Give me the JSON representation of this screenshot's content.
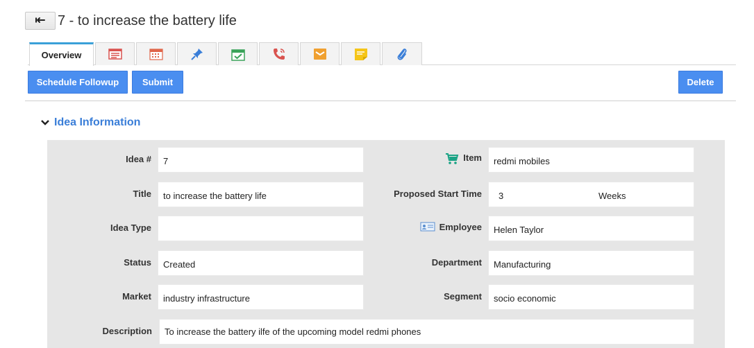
{
  "header": {
    "back_icon": "back-arrow-icon",
    "title": "7 - to increase the battery life"
  },
  "tabs": [
    {
      "label": "Overview",
      "icon": null
    },
    {
      "label": "",
      "icon": "notes-list-icon"
    },
    {
      "label": "",
      "icon": "calendar-icon"
    },
    {
      "label": "",
      "icon": "pin-icon"
    },
    {
      "label": "",
      "icon": "task-check-icon"
    },
    {
      "label": "",
      "icon": "phone-call-icon"
    },
    {
      "label": "",
      "icon": "email-icon"
    },
    {
      "label": "",
      "icon": "sticky-note-icon"
    },
    {
      "label": "",
      "icon": "attachment-icon"
    }
  ],
  "actions": {
    "schedule_followup": "Schedule Followup",
    "submit": "Submit",
    "delete": "Delete"
  },
  "section": {
    "title": "Idea Information",
    "toggle_icon": "chevron-down-icon"
  },
  "fields": {
    "idea_no": {
      "label": "Idea #",
      "value": "7"
    },
    "item": {
      "label": "Item",
      "value": "redmi mobiles",
      "icon": "shopping-cart-icon"
    },
    "title": {
      "label": "Title",
      "value": "to increase the battery life"
    },
    "proposed_start_time": {
      "label": "Proposed Start Time",
      "value": "3",
      "unit": "Weeks"
    },
    "idea_type": {
      "label": "Idea Type",
      "value": ""
    },
    "employee": {
      "label": "Employee",
      "value": "Helen Taylor",
      "icon": "contact-card-icon"
    },
    "status": {
      "label": "Status",
      "value": "Created"
    },
    "department": {
      "label": "Department",
      "value": "Manufacturing"
    },
    "market": {
      "label": "Market",
      "value": "industry infrastructure"
    },
    "segment": {
      "label": "Segment",
      "value": "socio economic"
    },
    "description": {
      "label": "Description",
      "value": "To increase the battery ilfe of the upcoming model redmi phones"
    }
  },
  "colors": {
    "primary_button": "#4a8ef0",
    "section_title": "#3a7ed8",
    "tab_active_border": "#3aa0d8",
    "panel_bg": "#e6e6e6"
  }
}
